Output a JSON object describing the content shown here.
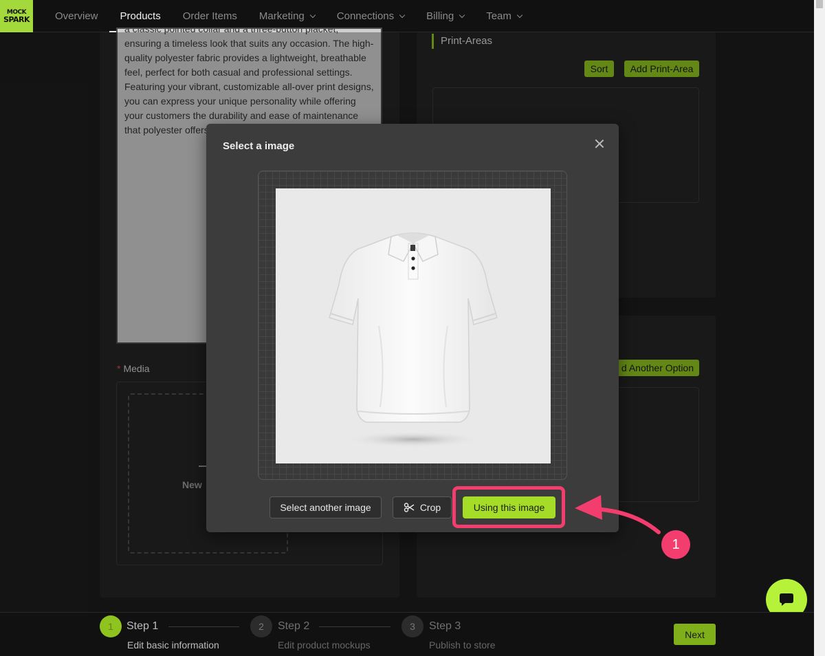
{
  "nav": {
    "logo_top": "MOCK",
    "logo_bottom": "SPARK",
    "items": [
      {
        "label": "Overview"
      },
      {
        "label": "Products"
      },
      {
        "label": "Order Items"
      },
      {
        "label": "Marketing"
      },
      {
        "label": "Connections"
      },
      {
        "label": "Billing"
      },
      {
        "label": "Team"
      }
    ],
    "active": "Products"
  },
  "page": {
    "description_visible": "a classic pointed collar and a three-button placket, ensuring a timeless look that suits any occasion. The high-quality polyester fabric provides a lightweight, breathable feel, perfect for both casual and professional settings. Featuring your vibrant, customizable all-over print designs, you can express your unique personality while offering your customers the durability and ease of maintenance that polyester offers.",
    "media_label": "Media",
    "media_button_partial": "New",
    "print_areas_title": "Print-Areas",
    "sort_button": "Sort",
    "add_print_area_button": "Add Print-Area",
    "add_option_button_partial": "d Another Option"
  },
  "modal": {
    "title": "Select a image",
    "image_subject": "white polo shirt mockup",
    "buttons": {
      "select_another": "Select another image",
      "crop": "Crop",
      "use": "Using this image"
    }
  },
  "annotation": {
    "callout_number": "1",
    "color": "#f23d6e"
  },
  "steps": [
    {
      "num": "1",
      "title": "Step 1",
      "desc": "Edit basic information"
    },
    {
      "num": "2",
      "title": "Step 2",
      "desc": "Edit product mockups"
    },
    {
      "num": "3",
      "title": "Step 3",
      "desc": "Publish to store"
    }
  ],
  "next_button": "Next",
  "colors": {
    "accent": "#a5dc28",
    "background": "#1c1c1c"
  }
}
